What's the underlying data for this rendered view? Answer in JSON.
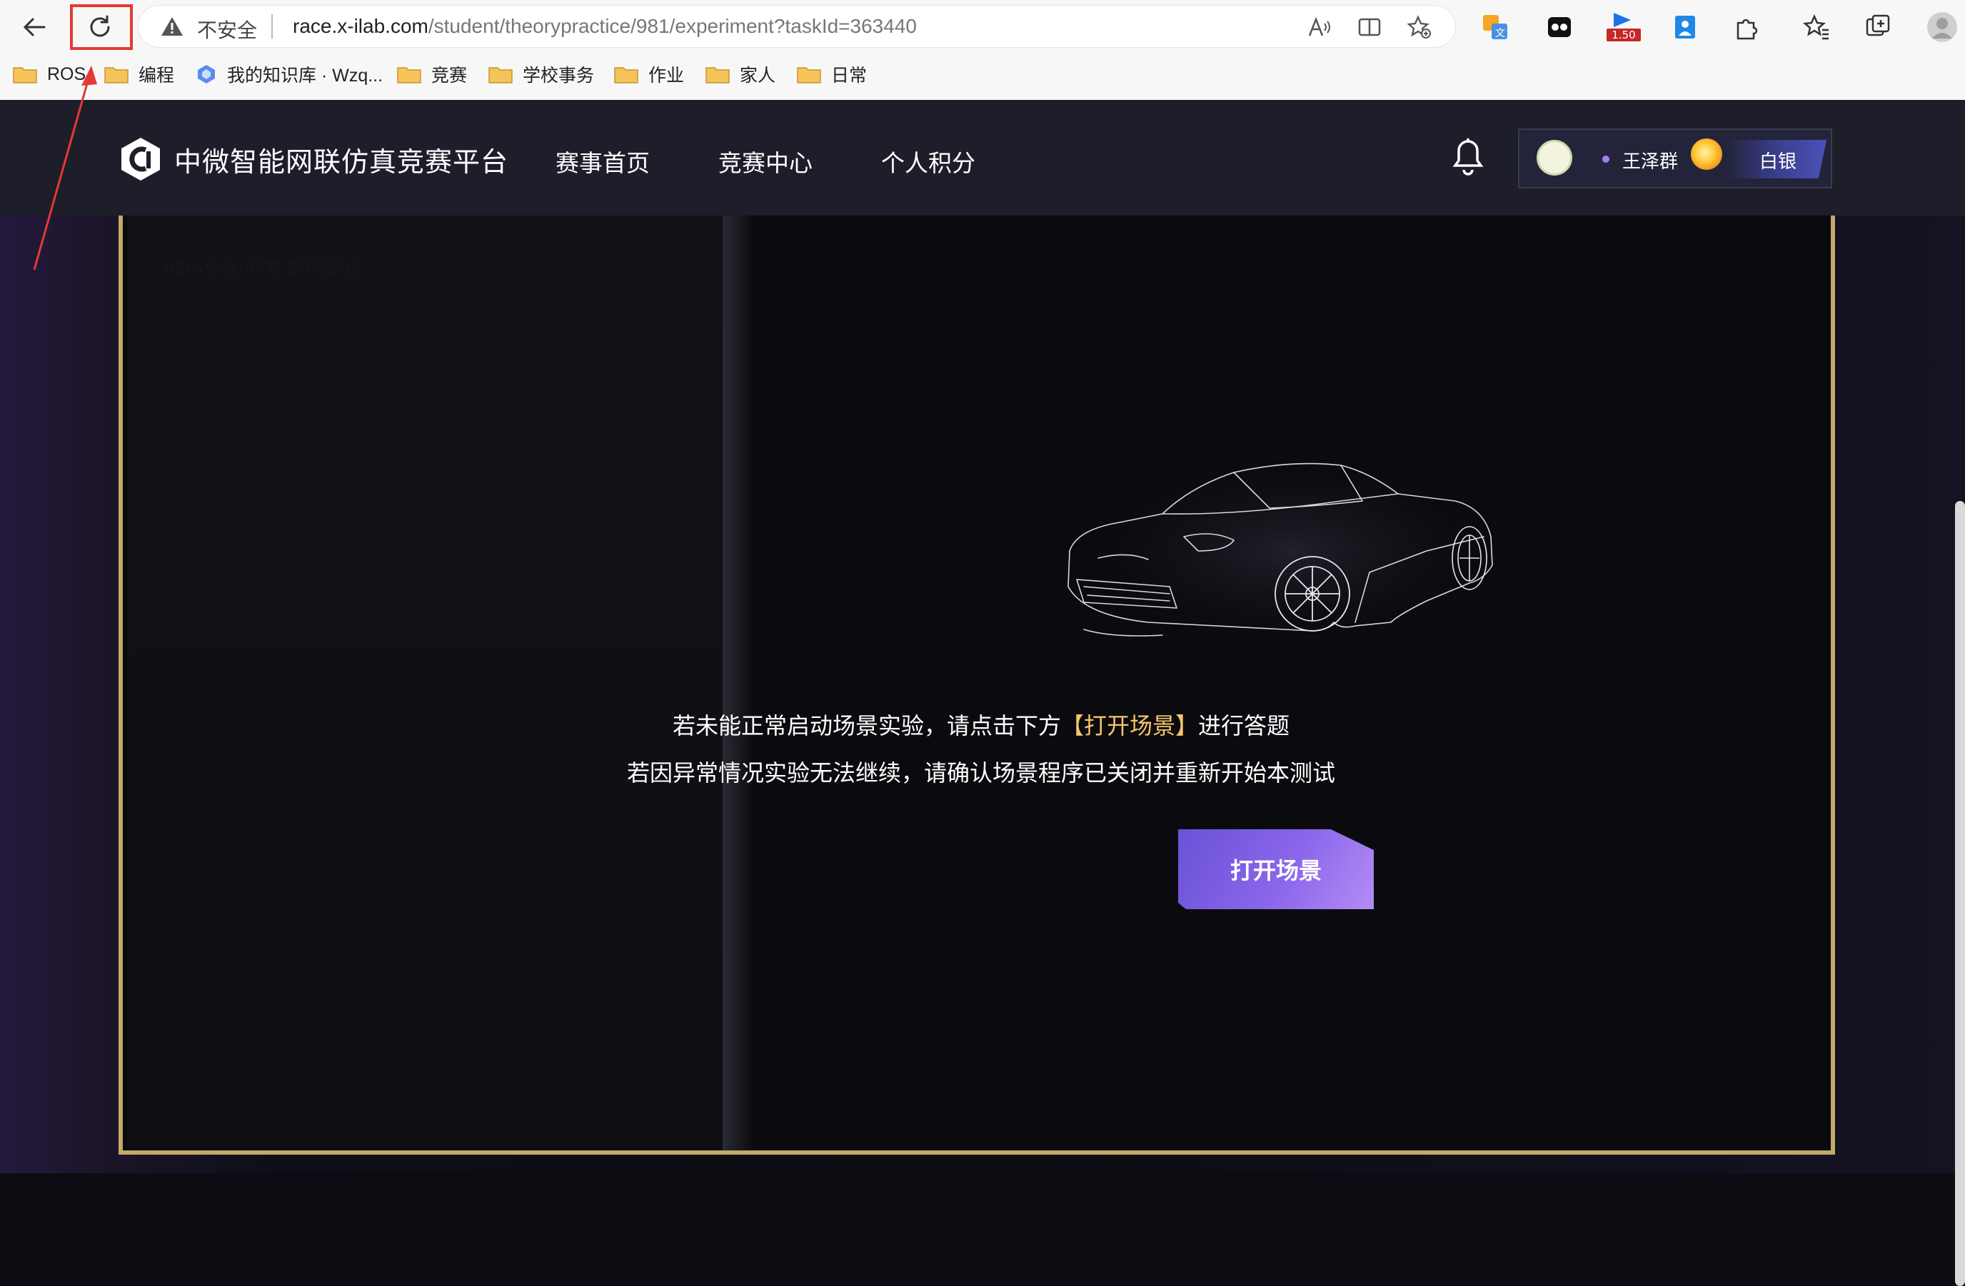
{
  "browser": {
    "address_warning": "不安全",
    "url_host": "race.x-ilab.com",
    "url_path": "/student/theorypractice/981/experiment?taskId=363440",
    "ext_badge": "1.50",
    "bookmarks": [
      "ROS",
      "编程",
      "我的知识库 · Wzq...",
      "竞赛",
      "学校事务",
      "作业",
      "家人",
      "日常"
    ]
  },
  "site": {
    "logo_text": "中微智能网联仿真竞赛平台",
    "nav": [
      "赛事首页",
      "竞赛中心",
      "个人积分"
    ],
    "user_name": "王泽群",
    "rank": "白银"
  },
  "experiment": {
    "left_label": "ADAS组-前方车辆跟止",
    "msg1_pre": "若未能正常启动场景实验，请点击下方",
    "msg1_highlight": "【打开场景】",
    "msg1_post": "进行答题",
    "msg2": "若因异常情况实验无法继续，请确认场景程序已关闭并重新开始本测试",
    "open_button": "打开场景"
  }
}
